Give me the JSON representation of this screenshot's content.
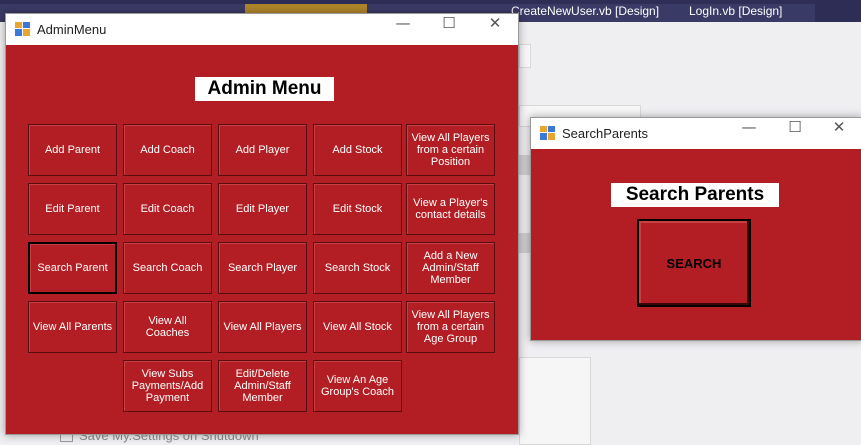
{
  "ide": {
    "tabs": [
      "CreateNewUser.vb [Design]",
      "LogIn.vb [Design]"
    ],
    "checkbox_label": "Save My.Settings on Shutdown"
  },
  "admin_window": {
    "title": "AdminMenu",
    "minimize": "—",
    "maximize": "☐",
    "close": "✕",
    "heading": "Admin Menu",
    "buttons": [
      [
        "Add Parent",
        "Add Coach",
        "Add Player",
        "Add Stock",
        "View All Players from a certain Position"
      ],
      [
        "Edit Parent",
        "Edit Coach",
        "Edit Player",
        "Edit Stock",
        "View a Player's contact details"
      ],
      [
        "Search Parent",
        "Search Coach",
        "Search Player",
        "Search Stock",
        "Add a New Admin/Staff Member"
      ],
      [
        "View All Parents",
        "View All Coaches",
        "View All Players",
        "View All Stock",
        "View All Players from a certain Age Group"
      ],
      [
        "",
        "View Subs Payments/Add Payment",
        "Edit/Delete Admin/Staff Member",
        "View An Age Group's Coach",
        ""
      ]
    ]
  },
  "search_window": {
    "title": "SearchParents",
    "minimize": "—",
    "maximize": "☐",
    "close": "✕",
    "heading": "Search Parents",
    "search_button": "SEARCH"
  },
  "colors": {
    "form_red": "#b21e23",
    "ide_title": "#2d2d55"
  }
}
